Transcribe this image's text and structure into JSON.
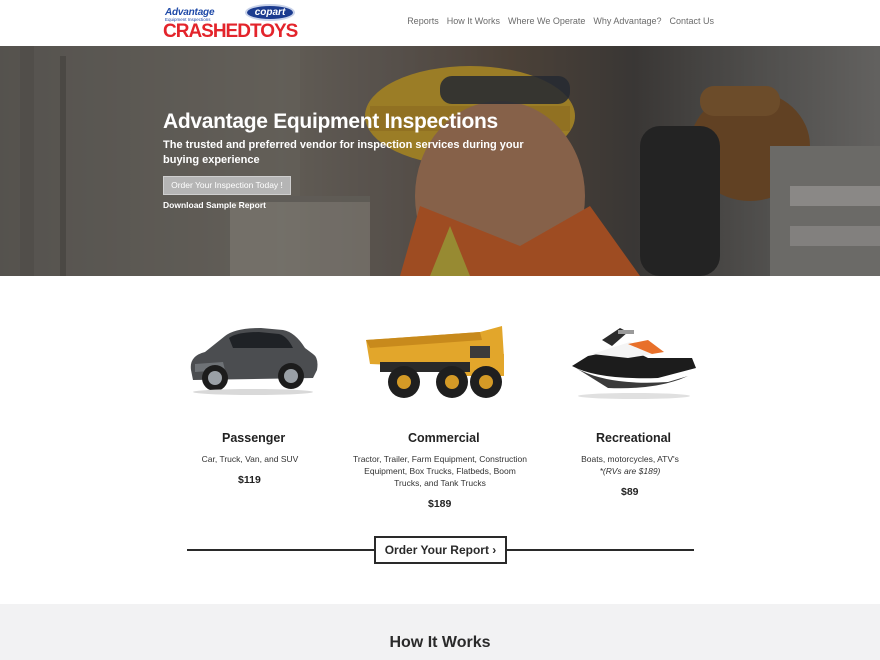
{
  "brand": {
    "advantage": "Advantage",
    "advantage_sub": "Equipment Inspections",
    "copart": "copart",
    "crashedtoys": "CRASHEDTOYS"
  },
  "nav": {
    "items": [
      "Reports",
      "How It Works",
      "Where We Operate",
      "Why Advantage?",
      "Contact Us"
    ]
  },
  "hero": {
    "title": "Advantage Equipment Inspections",
    "subtitle": "The trusted and preferred vendor for inspection services during your buying experience",
    "cta": "Order Your Inspection Today !",
    "link": "Download Sample Report"
  },
  "services": [
    {
      "title": "Passenger",
      "desc": "Car, Truck, Van, and SUV",
      "note": "",
      "price": "$119",
      "icon": "suv-car-image"
    },
    {
      "title": "Commercial",
      "desc": "Tractor, Trailer, Farm Equipment, Construction Equipment, Box Trucks, Flatbeds, Boom Trucks, and Tank Trucks",
      "note": "",
      "price": "$189",
      "icon": "dump-truck-image"
    },
    {
      "title": "Recreational",
      "desc": "Boats, motorcycles, ATV's",
      "note": "*(RVs are $189)",
      "price": "$89",
      "icon": "jet-ski-image"
    }
  ],
  "order": {
    "label": "Order Your Report ›"
  },
  "how": {
    "title": "How It Works"
  },
  "colors": {
    "brand_red": "#e3242b",
    "brand_blue": "#1f4aa8",
    "dark": "#2a2a2a",
    "section_gray": "#f2f2f3"
  }
}
